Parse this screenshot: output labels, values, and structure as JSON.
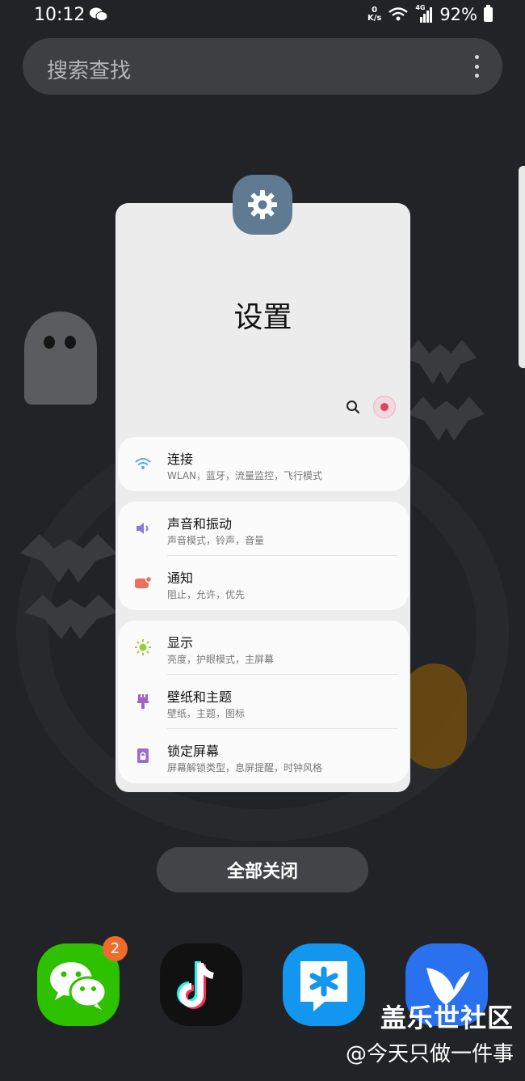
{
  "status_bar": {
    "time": "10:12",
    "net_speed_value": "0",
    "net_speed_unit": "K/s",
    "network": "4G",
    "battery": "92%"
  },
  "search_bar": {
    "placeholder": "搜索查找"
  },
  "recent_app": {
    "title": "设置",
    "settings_groups": [
      {
        "items": [
          {
            "label": "连接",
            "subtitle": "WLAN，蓝牙，流量监控，飞行模式",
            "icon": "wifi-icon",
            "color": "#5aa6e0"
          }
        ]
      },
      {
        "items": [
          {
            "label": "声音和振动",
            "subtitle": "声音模式，铃声，音量",
            "icon": "speaker-icon",
            "color": "#8a7ad6"
          },
          {
            "label": "通知",
            "subtitle": "阻止，允许，优先",
            "icon": "notification-icon",
            "color": "#ec6f62"
          }
        ]
      },
      {
        "items": [
          {
            "label": "显示",
            "subtitle": "亮度，护眼模式，主屏幕",
            "icon": "sun-icon",
            "color": "#9acb3c"
          },
          {
            "label": "壁纸和主题",
            "subtitle": "壁纸，主题，图标",
            "icon": "brush-icon",
            "color": "#a55fc7"
          },
          {
            "label": "锁定屏幕",
            "subtitle": "屏幕解锁类型，息屏提醒，时钟风格",
            "icon": "lock-icon",
            "color": "#9a6fc9"
          }
        ]
      }
    ]
  },
  "close_all_label": "全部关闭",
  "dock": [
    {
      "name": "wechat",
      "icon": "wechat-icon",
      "badge": "2",
      "color": "#2dc100"
    },
    {
      "name": "tiktok",
      "icon": "tiktok-icon",
      "color": "#111111"
    },
    {
      "name": "tim",
      "icon": "tim-icon",
      "color": "#1296f0"
    },
    {
      "name": "feishu",
      "icon": "bird-icon",
      "color": "#2a71f0"
    }
  ],
  "watermark": {
    "line1": "盖乐世社区",
    "line2": "@今天只做一件事"
  }
}
